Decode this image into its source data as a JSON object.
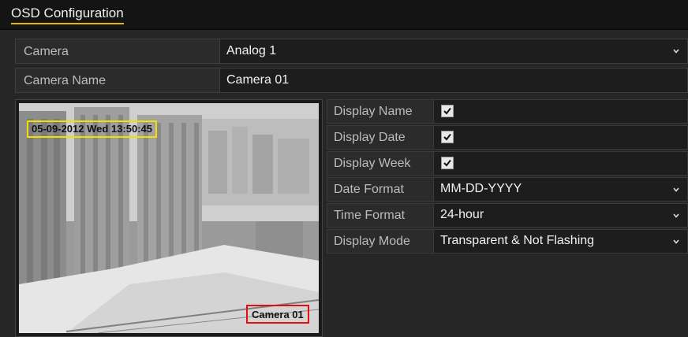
{
  "window": {
    "title": "OSD Configuration"
  },
  "camera": {
    "label": "Camera",
    "value": "Analog 1"
  },
  "camera_name": {
    "label": "Camera Name",
    "value": "Camera 01"
  },
  "preview": {
    "osd_date_text": "05-09-2012 Wed 13:50:45",
    "osd_name_text": "Camera 01",
    "date_box_color": "#f2e000",
    "name_box_color": "#e01010"
  },
  "settings": {
    "display_name": {
      "label": "Display Name",
      "checked": true
    },
    "display_date": {
      "label": "Display Date",
      "checked": true
    },
    "display_week": {
      "label": "Display Week",
      "checked": true
    },
    "date_format": {
      "label": "Date Format",
      "value": "MM-DD-YYYY"
    },
    "time_format": {
      "label": "Time Format",
      "value": "24-hour"
    },
    "display_mode": {
      "label": "Display Mode",
      "value": "Transparent & Not Flashing"
    }
  },
  "colors": {
    "accent": "#e8b800",
    "background": "#262626"
  },
  "icons": {
    "dropdown": "chevron-down-icon",
    "checkbox": "checkmark-icon"
  }
}
